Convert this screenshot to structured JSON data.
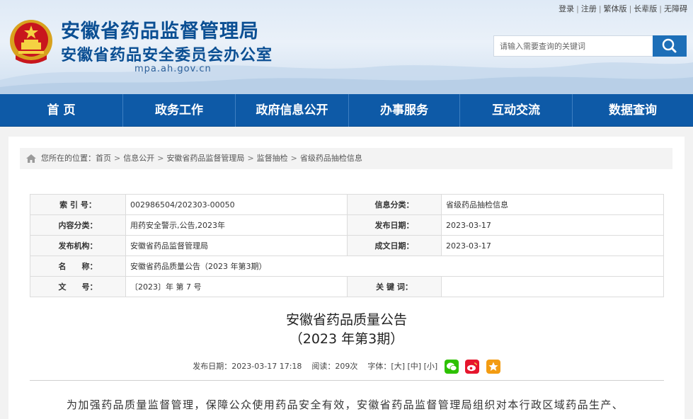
{
  "header": {
    "title_main": "安徽省药品监督管理局",
    "title_sub": "安徽省药品安全委员会办公室",
    "domain": "mpa.ah.gov.cn",
    "top_links": [
      "登录",
      "注册",
      "繁体版",
      "长辈版",
      "无障碍"
    ],
    "search_placeholder": "请输入需要查询的关键词",
    "brand_color": "#0e5aa7"
  },
  "nav": {
    "items": [
      "首 页",
      "政务工作",
      "政府信息公开",
      "办事服务",
      "互动交流",
      "数据查询"
    ]
  },
  "breadcrumb": {
    "prefix": "您所在的位置：",
    "items": [
      "首页",
      "信息公开",
      "安徽省药品监督管理局",
      "监督抽检",
      "省级药品抽检信息"
    ]
  },
  "info_table": {
    "index_label": "索 引 号：",
    "index_value": "002986504/202303-00050",
    "category_label": "信息分类：",
    "category_value": "省级药品抽检信息",
    "content_class_label": "内容分类：",
    "content_class_value": "用药安全警示,公告,2023年",
    "publish_date_label": "发布日期：",
    "publish_date_value": "2023-03-17",
    "org_label": "发布机构：",
    "org_value": "安徽省药品监督管理局",
    "created_label": "成文日期：",
    "created_value": "2023-03-17",
    "name_label": "名　　称：",
    "name_value": "安徽省药品质量公告（2023 年第3期）",
    "doc_no_label": "文　　号：",
    "doc_no_value": "〔2023〕年 第 7 号",
    "keywords_label": "关 键 词：",
    "keywords_value": ""
  },
  "article": {
    "title_line1": "安徽省药品质量公告",
    "title_line2": "（2023 年第3期）",
    "publish_time": "发布日期：2023-03-17 17:18",
    "views": "阅读：209次",
    "font_size_label": "字体：",
    "size_large": "[大]",
    "size_medium": "[中]",
    "size_small": "[小]",
    "share_icons": [
      "wechat-icon",
      "weibo-icon",
      "favorite-star-icon"
    ],
    "paragraph": "为加强药品质量监督管理，保障公众使用药品安全有效，安徽省药品监督管理局组织对本行政区域药品生产、"
  }
}
